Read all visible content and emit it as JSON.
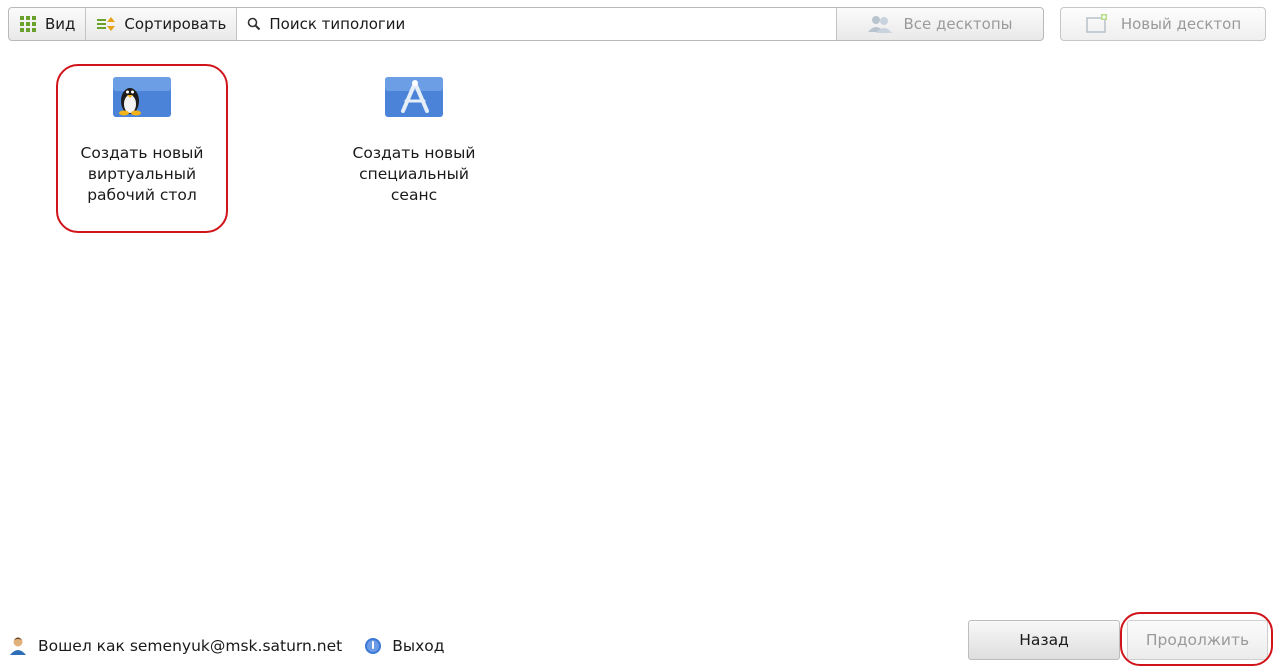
{
  "toolbar": {
    "view_label": "Вид",
    "sort_label": "Сортировать",
    "search_placeholder": "Поиск типологии",
    "all_desktops_label": "Все десктопы",
    "new_desktop_label": "Новый десктоп"
  },
  "tiles": [
    {
      "label_line1": "Создать новый",
      "label_line2": "виртуальный",
      "label_line3": "рабочий стол",
      "icon": "linux-penguin-icon"
    },
    {
      "label_line1": "Создать новый",
      "label_line2": "специальный",
      "label_line3": "сеанс",
      "icon": "app-compass-icon"
    }
  ],
  "footer": {
    "logged_in_label": "Вошел как semenyuk@msk.saturn.net",
    "logout_label": "Выход",
    "back_label": "Назад",
    "continue_label": "Продолжить"
  },
  "colors": {
    "highlight": "#d0141a",
    "icon_blue": "#4a83d8",
    "disabled_text": "#9a9a9a"
  }
}
